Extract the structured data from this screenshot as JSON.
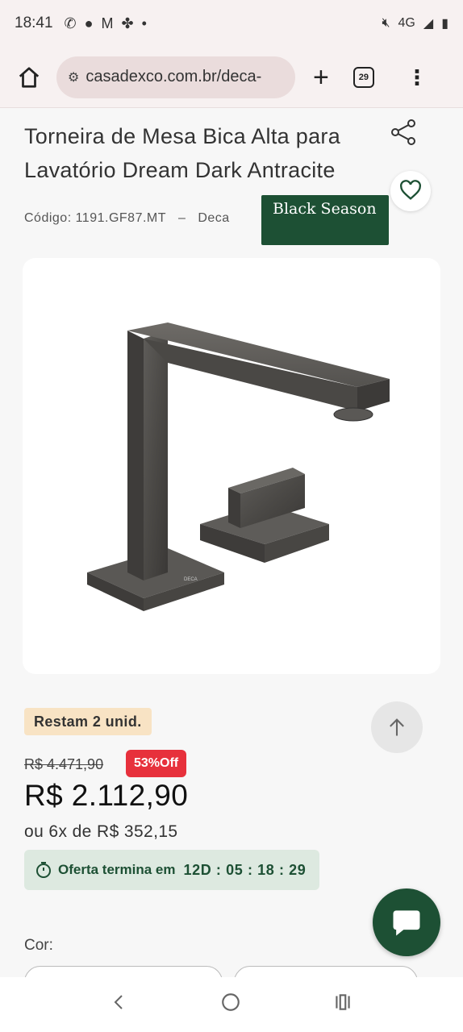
{
  "status": {
    "time": "18:41",
    "network": "4G"
  },
  "browser": {
    "url": "casadexco.com.br/deca-",
    "tab_count": "29"
  },
  "product": {
    "title": "Torneira de Mesa Bica Alta para Lavatório Dream Dark Antracite",
    "code": "Código: 1191.GF87.MT",
    "separator": "–",
    "brand": "Deca",
    "promo_badge": "Black Season",
    "stock": "Restam 2 unid.",
    "old_price": "R$ 4.471,90",
    "discount": "53%Off",
    "price": "R$ 2.112,90",
    "installments": "ou 6x de R$ 352,15",
    "offer_label": "Oferta termina em",
    "countdown": "12D : 05 : 18 : 29",
    "color_label": "Cor:"
  },
  "colors": {
    "accent": "#1d5034",
    "discount": "#e7313c",
    "stock_bg": "#f8e3c4"
  }
}
